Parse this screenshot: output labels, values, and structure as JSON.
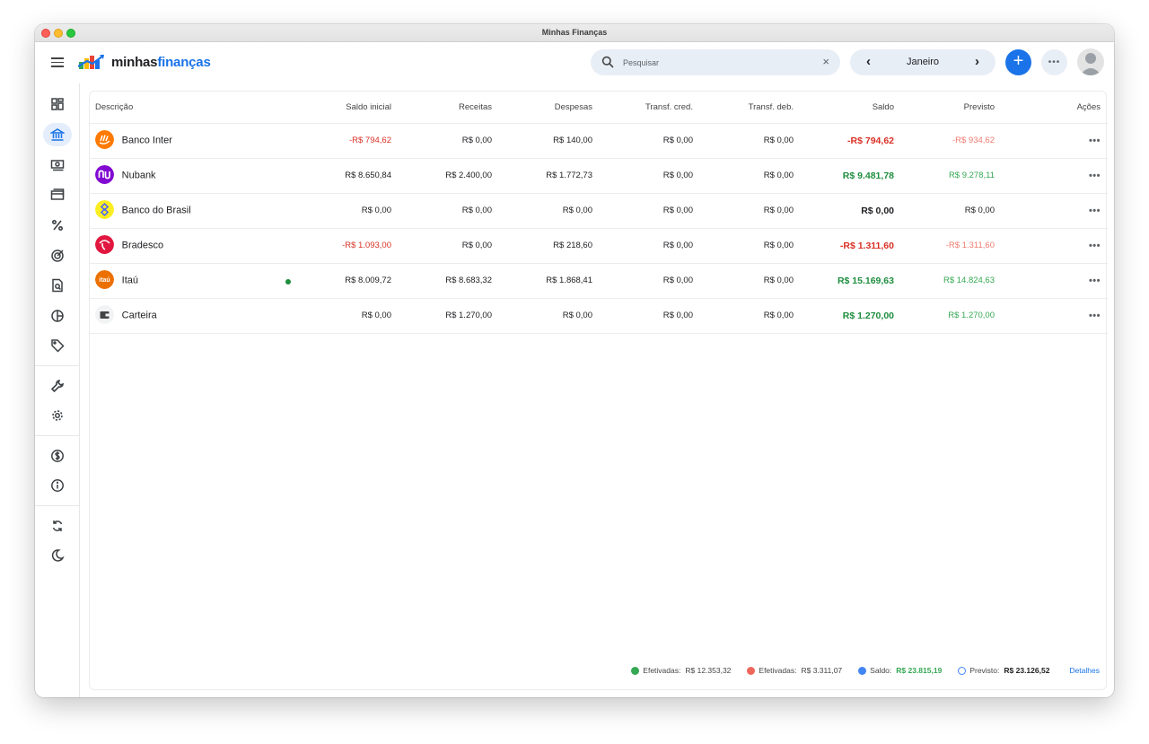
{
  "window": {
    "title": "Minhas Finanças"
  },
  "brand": {
    "name_part1": "minhas",
    "name_part2": "finanças"
  },
  "search": {
    "placeholder": "Pesquisar",
    "clear_glyph": "×"
  },
  "month_nav": {
    "label": "Janeiro",
    "prev_glyph": "‹",
    "next_glyph": "›"
  },
  "toolbar": {
    "add_glyph": "+",
    "more_glyph": "•••"
  },
  "colors": {
    "accent": "#1a73e8",
    "positive": "#1e8e3e",
    "negative": "#d93025"
  },
  "sidebar": {
    "items": [
      {
        "icon": "dashboard-icon",
        "active": false
      },
      {
        "icon": "bank-icon",
        "active": true
      },
      {
        "icon": "money-icon",
        "active": false
      },
      {
        "icon": "credit-card-icon",
        "active": false
      },
      {
        "icon": "percent-icon",
        "active": false
      },
      {
        "icon": "target-icon",
        "active": false
      },
      {
        "icon": "report-search-icon",
        "active": false
      },
      {
        "icon": "pie-chart-icon",
        "active": false
      },
      {
        "icon": "tag-icon",
        "active": false
      },
      {
        "icon": "wrench-icon",
        "active": false
      },
      {
        "icon": "gear-icon",
        "active": false
      },
      {
        "icon": "dollar-circle-icon",
        "active": false
      },
      {
        "icon": "info-icon",
        "active": false
      },
      {
        "icon": "sync-icon",
        "active": false
      },
      {
        "icon": "dark-mode-icon",
        "active": false
      }
    ]
  },
  "table": {
    "columns": [
      "Descrição",
      "Saldo inicial",
      "Receitas",
      "Despesas",
      "Transf. cred.",
      "Transf. deb.",
      "Saldo",
      "Previsto",
      "Ações"
    ],
    "rows": [
      {
        "name": "Banco Inter",
        "logo": "banco-inter-logo",
        "saldo_inicial": "-R$ 794,62",
        "receitas": "R$ 0,00",
        "despesas": "R$ 140,00",
        "transf_cred": "R$ 0,00",
        "transf_deb": "R$ 0,00",
        "saldo": "-R$ 794,62",
        "previsto": "-R$ 934,62",
        "actions": "•••"
      },
      {
        "name": "Nubank",
        "logo": "nubank-logo",
        "saldo_inicial": "R$ 8.650,84",
        "receitas": "R$ 2.400,00",
        "despesas": "R$ 1.772,73",
        "transf_cred": "R$ 0,00",
        "transf_deb": "R$ 0,00",
        "saldo": "R$ 9.481,78",
        "previsto": "R$ 9.278,11",
        "actions": "•••"
      },
      {
        "name": "Banco do Brasil",
        "logo": "banco-do-brasil-logo",
        "saldo_inicial": "R$ 0,00",
        "receitas": "R$ 0,00",
        "despesas": "R$ 0,00",
        "transf_cred": "R$ 0,00",
        "transf_deb": "R$ 0,00",
        "saldo": "R$ 0,00",
        "previsto": "R$ 0,00",
        "actions": "•••"
      },
      {
        "name": "Bradesco",
        "logo": "bradesco-logo",
        "saldo_inicial": "-R$ 1.093,00",
        "receitas": "R$ 0,00",
        "despesas": "R$ 218,60",
        "transf_cred": "R$ 0,00",
        "transf_deb": "R$ 0,00",
        "saldo": "-R$ 1.311,60",
        "previsto": "-R$ 1.311,60",
        "actions": "•••"
      },
      {
        "name": "Itaú",
        "logo": "itau-logo",
        "logo_text": "itaú",
        "saldo_inicial": "R$ 8.009,72",
        "receitas": "R$ 8.683,32",
        "despesas": "R$ 1.868,41",
        "transf_cred": "R$ 0,00",
        "transf_deb": "R$ 0,00",
        "saldo": "R$ 15.169,63",
        "previsto": "R$ 14.824,63",
        "actions": "•••"
      },
      {
        "name": "Carteira",
        "logo": "wallet-icon",
        "saldo_inicial": "R$ 0,00",
        "receitas": "R$ 1.270,00",
        "despesas": "R$ 0,00",
        "transf_cred": "R$ 0,00",
        "transf_deb": "R$ 0,00",
        "saldo": "R$ 1.270,00",
        "previsto": "R$ 1.270,00",
        "actions": "•••"
      }
    ]
  },
  "footer": {
    "receitas_label": "Efetivadas:",
    "receitas_value": "R$ 12.353,32",
    "despesas_label": "Efetivadas:",
    "despesas_value": "R$ 3.311,07",
    "saldo_label": "Saldo:",
    "saldo_value": "R$ 23.815,19",
    "previsto_label": "Previsto:",
    "previsto_value": "R$ 23.126,52",
    "details_link": "Detalhes"
  }
}
